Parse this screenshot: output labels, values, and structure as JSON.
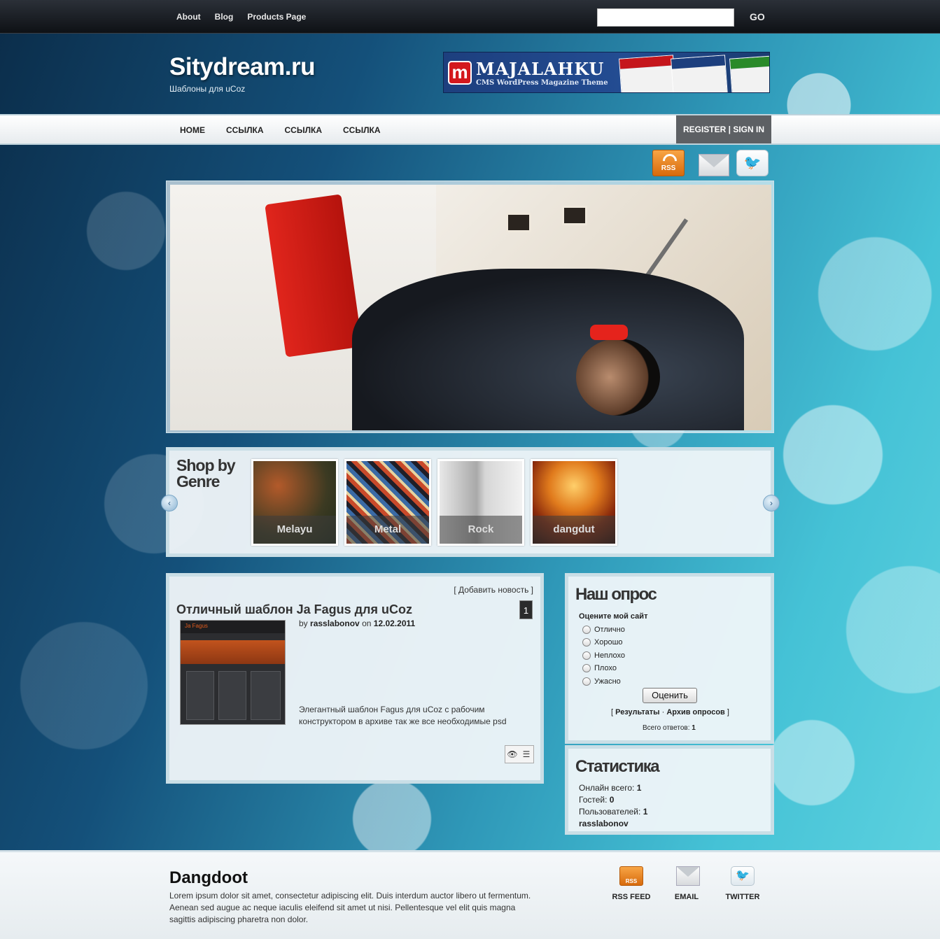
{
  "topnav": {
    "items": [
      "About",
      "Blog",
      "Products Page"
    ],
    "search_placeholder": "",
    "search_button": "GO"
  },
  "header": {
    "title": "Sitydream.ru",
    "subtitle": "Шаблоны для uCoz"
  },
  "banner": {
    "logo_letter": "m",
    "name": "MAJALAHKU",
    "tagline": "CMS WordPress Magazine Theme",
    "shot_label": "MAJALAHKU"
  },
  "mainnav": {
    "items": [
      "HOME",
      "ССЫЛКА",
      "ССЫЛКА",
      "ССЫЛКА"
    ],
    "register": "REGISTER | SIGN IN"
  },
  "social": {
    "rss": "RSS"
  },
  "genre": {
    "title": "Shop by Genre",
    "items": [
      "Melayu",
      "Metal",
      "Rock",
      "dangdut"
    ],
    "prev": "‹",
    "next": "›"
  },
  "news": {
    "add_link": "[ Добавить новость ]",
    "title": "Отличный шаблон Ja Fagus для uCoz",
    "count": "1",
    "byline_by": "by",
    "author": "rasslabonov",
    "byline_on": "on",
    "date": "12.02.2011",
    "thumb_label": "Ja Fagus",
    "excerpt": "Элегантный шаблон Fagus для uCoz с рабочим конструктором в архиве так же все необходимые psd"
  },
  "poll": {
    "title": "Наш опрос",
    "question": "Оцените мой сайт",
    "options": [
      "Отлично",
      "Хорошо",
      "Неплохо",
      "Плохо",
      "Ужасно"
    ],
    "button": "Оценить",
    "results": "Результаты",
    "archive": "Архив опросов",
    "total_label": "Всего ответов:",
    "total_value": "1"
  },
  "stats": {
    "title": "Статистика",
    "online_label": "Онлайн всего:",
    "online_value": "1",
    "guests_label": "Гостей:",
    "guests_value": "0",
    "users_label": "Пользователей:",
    "users_value": "1",
    "user_name": "rasslabonov"
  },
  "footer": {
    "title": "Dangdoot",
    "text": "Lorem ipsum dolor sit amet, consectetur adipiscing elit. Duis interdum auctor libero ut fermentum. Aenean sed augue ac neque iaculis eleifend sit amet ut nisi. Pellentesque vel elit quis magna sagittis adipiscing pharetra non dolor.",
    "links": [
      "RSS FEED",
      "EMAIL",
      "TWITTER"
    ],
    "rss_icon_text": "RSS"
  },
  "colors": {
    "accent_orange": "#d76a0c",
    "nav_dark": "#5d6064",
    "background_teal": "#45c2d6"
  }
}
